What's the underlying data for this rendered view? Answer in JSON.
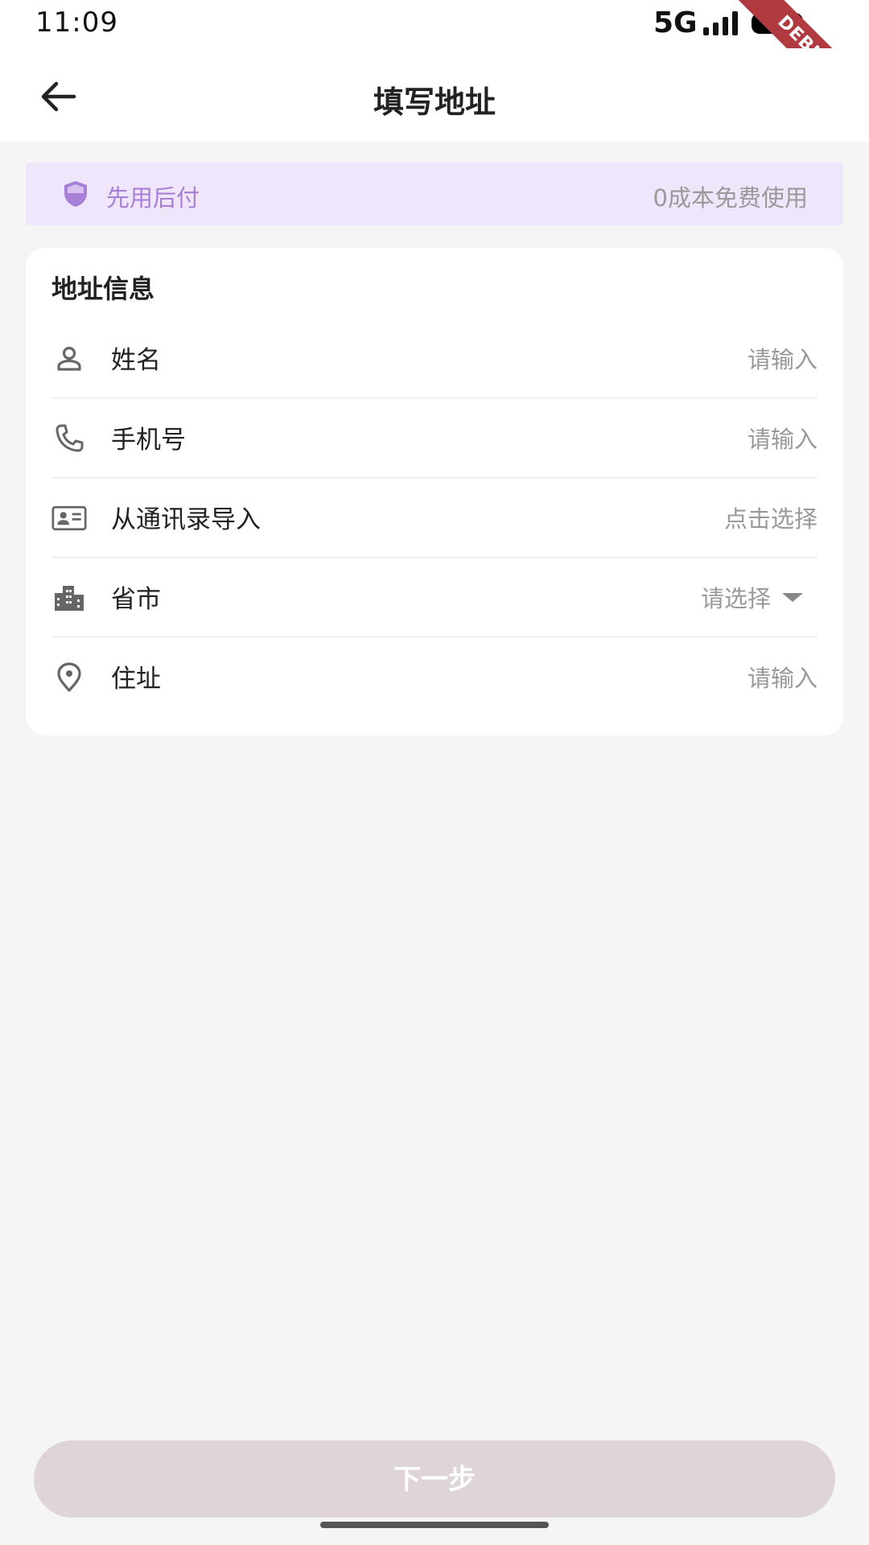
{
  "status_bar": {
    "time": "11:09",
    "network": "5G"
  },
  "debug_ribbon": "DEBUG",
  "header": {
    "title": "填写地址"
  },
  "banner": {
    "left_text": "先用后付",
    "right_text": "0成本免费使用",
    "accent_color": "#a77fd6",
    "background_color": "#f0e6fc"
  },
  "address_card": {
    "title": "地址信息",
    "rows": [
      {
        "icon": "person-icon",
        "label": "姓名",
        "value": "请输入"
      },
      {
        "icon": "phone-icon",
        "label": "手机号",
        "value": "请输入"
      },
      {
        "icon": "contact-card-icon",
        "label": "从通讯录导入",
        "value": "点击选择"
      },
      {
        "icon": "building-icon",
        "label": "省市",
        "value": "请选择"
      },
      {
        "icon": "location-pin-icon",
        "label": "住址",
        "value": "请输入"
      }
    ]
  },
  "footer": {
    "next_label": "下一步",
    "button_color": "#dfd4d9"
  }
}
